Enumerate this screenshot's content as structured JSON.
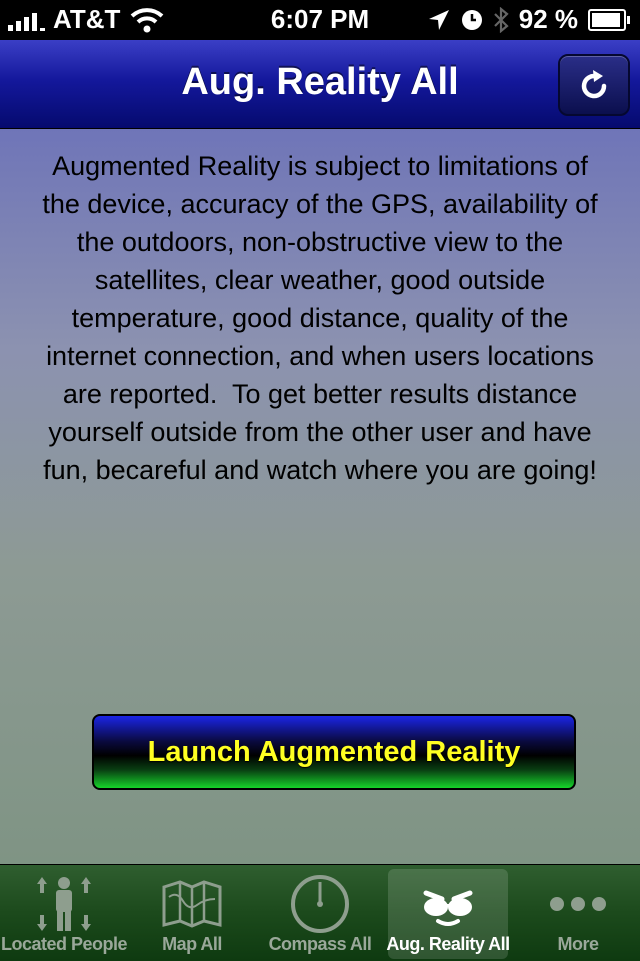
{
  "status_bar": {
    "carrier": "AT&T",
    "time": "6:07 PM",
    "battery_percent_text": "92 %",
    "battery_level": 0.92,
    "icons": [
      "signal-icon",
      "wifi-icon",
      "location-arrow-icon",
      "clock-icon",
      "bluetooth-icon",
      "battery-icon"
    ]
  },
  "nav": {
    "title": "Aug. Reality All",
    "right_button_icon": "refresh-icon"
  },
  "main": {
    "disclaimer": "Augmented Reality is subject to limitations of the device, accuracy of the GPS, availability of the outdoors, non-obstructive view to the satellites, clear weather, good outside temperature, good distance, quality of the internet connection, and when users locations are reported.  To get better results distance yourself outside from the other user and have fun, becareful and watch where you are going!",
    "launch_button": "Launch Augmented Reality"
  },
  "tabs": [
    {
      "label": "Located People",
      "icon": "people-icon",
      "active": false
    },
    {
      "label": "Map All",
      "icon": "map-icon",
      "active": false
    },
    {
      "label": "Compass All",
      "icon": "compass-icon",
      "active": false
    },
    {
      "label": "Aug. Reality All",
      "icon": "face-glasses-icon",
      "active": true
    },
    {
      "label": "More",
      "icon": "more-dots-icon",
      "active": false
    }
  ],
  "colors": {
    "nav_bar": "#14189c",
    "tab_bar": "#1c4a1c",
    "launch_text": "#ffff22"
  }
}
